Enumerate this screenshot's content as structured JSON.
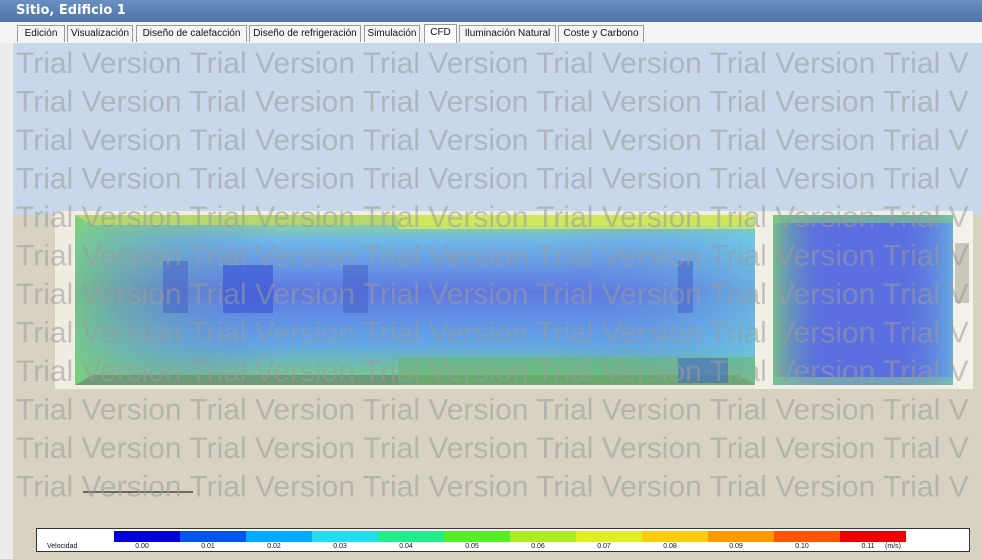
{
  "window": {
    "title": "Sitio, Edificio 1"
  },
  "tabs": [
    {
      "label": "Edición",
      "active": false
    },
    {
      "label": "Visualización",
      "active": false
    },
    {
      "label": "Diseño de calefacción",
      "active": false
    },
    {
      "label": "Diseño de refrigeración",
      "active": false
    },
    {
      "label": "Simulación",
      "active": false
    },
    {
      "label": "CFD",
      "active": true
    },
    {
      "label": "Iluminación Natural",
      "active": false
    },
    {
      "label": "Coste y Carbono",
      "active": false
    }
  ],
  "watermark": {
    "text": "Trial Version Trial Version Trial Version Trial Version Trial Version Trial V",
    "rows": 12
  },
  "legend": {
    "label": "Velocidad",
    "unit": "(m/s)",
    "ticks": [
      "0.00",
      "0.01",
      "0.02",
      "0.03",
      "0.04",
      "0.05",
      "0.06",
      "0.07",
      "0.08",
      "0.09",
      "0.10",
      "0.11"
    ],
    "colors": [
      "#0000dd",
      "#0055ee",
      "#00aaff",
      "#22ddee",
      "#22ee88",
      "#55ee22",
      "#aaee22",
      "#ddee22",
      "#ffcc11",
      "#ff9900",
      "#ff5500",
      "#ee0000"
    ]
  }
}
